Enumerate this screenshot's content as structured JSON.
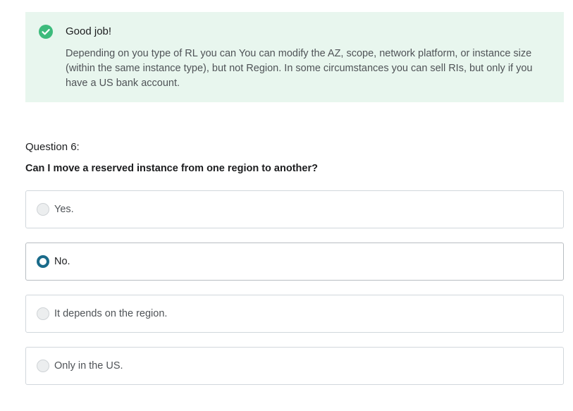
{
  "feedback": {
    "status": "success",
    "icon": "check-circle-icon",
    "accent_color": "#3dbb7c",
    "background_color": "#e8f6ee",
    "title": "Good job!",
    "text": "Depending on you type of RL you can You can modify the AZ, scope, network platform, or instance size (within the same instance type), but not Region. In some circumstances you can sell RIs, but only if you have a US bank account."
  },
  "question": {
    "label": "Question 6:",
    "text": "Can I move a reserved instance from one region to another?",
    "selected_index": 1,
    "options": [
      {
        "label": "Yes."
      },
      {
        "label": "No."
      },
      {
        "label": "It depends on the region."
      },
      {
        "label": "Only in the US."
      }
    ]
  },
  "colors": {
    "radio_selected": "#1a6b8a",
    "option_border": "#d1d7dc"
  }
}
